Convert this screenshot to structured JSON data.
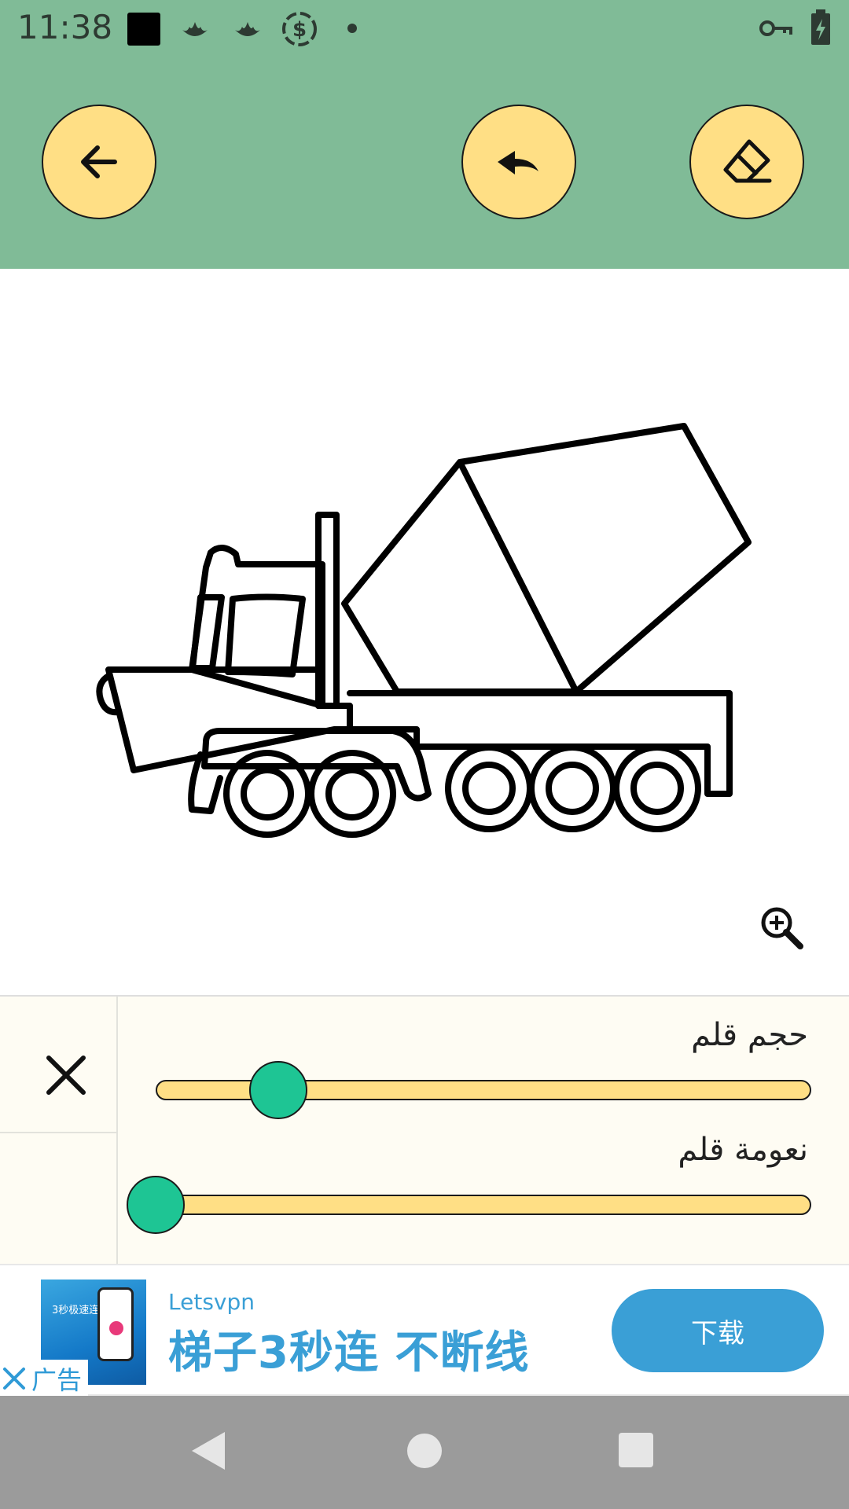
{
  "status_bar": {
    "time": "11:38",
    "icons_left": [
      "square-icon",
      "lotus-icon",
      "lotus-icon",
      "dollar-sync-icon",
      "dot-icon"
    ],
    "icons_right": [
      "key-icon",
      "battery-charging-icon"
    ]
  },
  "toolbar": {
    "back_icon": "arrow-left-icon",
    "undo_icon": "undo-icon",
    "eraser_icon": "eraser-icon",
    "button_color": "#ffdf85",
    "background_color": "#80bb97"
  },
  "canvas": {
    "image": "cement-mixer-truck-outline",
    "zoom_icon": "zoom-in-icon"
  },
  "pen_panel": {
    "close_icon": "close-icon",
    "pen_size": {
      "label": "حجم قلم",
      "value": 0.19
    },
    "pen_smoothness": {
      "label": "نعومة قلم",
      "value": 0.0
    },
    "thumb_color": "#1ec594",
    "track_color": "#ffdf85"
  },
  "ad": {
    "brand": "Letsvpn",
    "headline": "梯子3秒连 不断线",
    "cta": "下载",
    "badge": "广告",
    "thumb_text": "3秒极速连线",
    "accent_color": "#3a9fd6"
  },
  "nav_bar": {
    "back_icon": "nav-back-icon",
    "home_icon": "nav-home-icon",
    "recents_icon": "nav-recents-icon"
  }
}
